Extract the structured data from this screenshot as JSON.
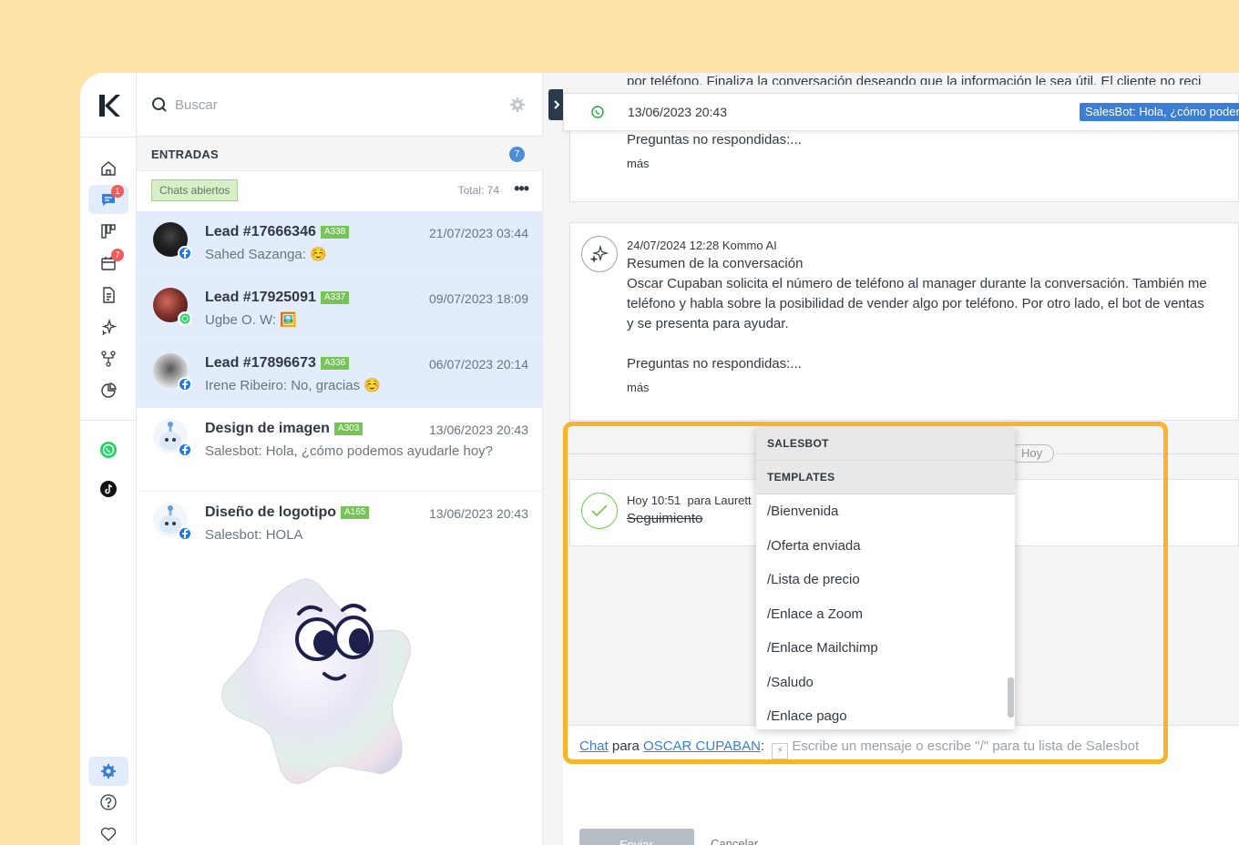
{
  "search": {
    "placeholder": "Buscar"
  },
  "inbox": {
    "title": "ENTRADAS",
    "count": "7",
    "filter_chip": "Chats abiertos",
    "total": "Total: 74",
    "more": "•••"
  },
  "rail": {
    "chats_badge": "1",
    "tasks_badge": "7"
  },
  "conversations": [
    {
      "title": "Lead #17666346",
      "tag": "A338",
      "time": "21/07/2023 03:44",
      "preview": "Sahed Sazanga: ☺️",
      "channel": "facebook"
    },
    {
      "title": "Lead #17925091",
      "tag": "A337",
      "time": "09/07/2023 18:09",
      "preview": "Ugbe O. W: 🖼️",
      "channel": "whatsapp"
    },
    {
      "title": "Lead #17896673",
      "tag": "A336",
      "time": "06/07/2023 20:14",
      "preview": "Irene Ribeiro: No, gracias ☺️",
      "channel": "facebook"
    },
    {
      "title": "Design de imagen",
      "tag": "A303",
      "time": "13/06/2023 20:43",
      "preview": "Salesbot: Hola, ¿cómo podemos ayudarle hoy?",
      "channel": "facebook"
    },
    {
      "title": "Diseño de logotipo",
      "tag": "A165",
      "time": "13/06/2023 20:43",
      "preview": "Salesbot: HOLA",
      "channel": "facebook"
    }
  ],
  "feed": {
    "top_clipped_text": "por teléfono. Finaliza la conversación deseando que la información le sea útil. El cliente no reci",
    "sticky": {
      "date": "13/06/2023 20:43",
      "pill": "SalesBot: Hola, ¿cómo poder"
    },
    "card1": {
      "text": "Preguntas no respondidas:...",
      "more": "más"
    },
    "card2": {
      "meta": "24/07/2024 12:28 Kommo AI",
      "title": "Resumen de la conversación",
      "line1": "Oscar Cupaban solicita el número de teléfono al manager durante la conversación. También me",
      "line2": "teléfono y habla sobre la posibilidad de vender algo por teléfono. Por otro lado, el bot de ventas",
      "line3": "y se presenta para ayudar.",
      "questions": "Preguntas no respondidas:...",
      "more": "más"
    },
    "day_separator": "Hoy",
    "task": {
      "time": "Hoy 10:51",
      "for": "para Laurett",
      "title": "Seguimiento"
    }
  },
  "composer": {
    "chat_link": "Chat",
    "para": " para ",
    "recipient": "OSCAR CUPABAN",
    "colon": ":",
    "placeholder": "Escribe un mensaje o escribe \"/\" para tu lista de Salesbot",
    "send_label": "Enviar",
    "cancel_label": "Cancelar"
  },
  "dropdown": {
    "sections": [
      "SALESBOT",
      "TEMPLATES"
    ],
    "items": [
      "/Bienvenida",
      "/Oferta enviada",
      "/Lista de precio",
      "/Enlace a Zoom",
      "/Enlace Mailchimp",
      "/Saludo",
      "/Enlace pago"
    ]
  },
  "colors": {
    "accent": "#3a7fd5",
    "highlight": "#f6b32b",
    "background": "#fde3a7",
    "tag_green": "#76c455"
  }
}
